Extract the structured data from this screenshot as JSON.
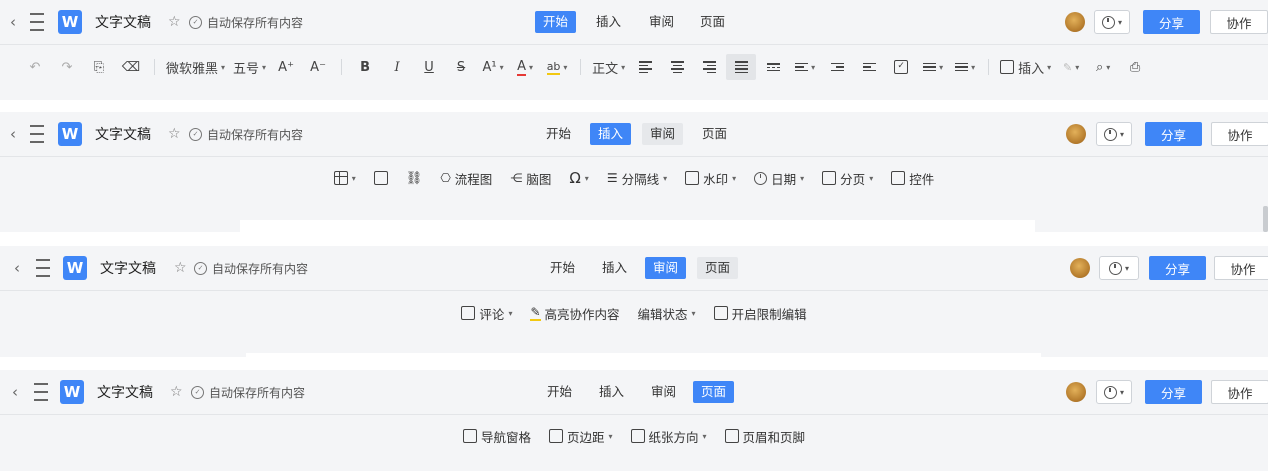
{
  "app": {
    "doc_title": "文字文稿",
    "autosave": "自动保存所有内容",
    "logo": "W",
    "back": "‹",
    "star": "☆",
    "saved": "✓",
    "caret": "▾",
    "share": "分享",
    "collab": "协作"
  },
  "tabs": [
    "开始",
    "插入",
    "审阅",
    "页面"
  ],
  "home_toolbar": {
    "font_name": "微软雅黑",
    "font_size": "五号",
    "grow": "A⁺",
    "shrink": "A⁻",
    "bold": "B",
    "italic": "I",
    "underline": "U",
    "strike": "S",
    "superscript": "A¹",
    "font_color": "A",
    "highlight": "ab",
    "style": "正文",
    "insert": "插入",
    "undo": "↶",
    "redo": "↷",
    "format_painter": "⎘",
    "eraser": "⌫",
    "search": "⌕",
    "print": "⎙",
    "wrench": "🔧"
  },
  "insert_toolbar": {
    "flowchart": "流程图",
    "mindmap": "脑图",
    "symbol": "Ω",
    "divider": "分隔线",
    "watermark": "水印",
    "date": "日期",
    "pagebreak": "分页",
    "control": "控件"
  },
  "review_toolbar": {
    "comment": "评论",
    "highlight_collab": "高亮协作内容",
    "edit_state": "编辑状态",
    "restrict": "开启限制编辑"
  },
  "page_toolbar": {
    "nav": "导航窗格",
    "margin": "页边距",
    "orientation": "纸张方向",
    "header_footer": "页眉和页脚"
  },
  "colors": {
    "accent": "#3f86f7",
    "panel_bg": "#f4f5f7",
    "font_color_underline": "#e53935",
    "highlight_underline": "#f2c811"
  }
}
